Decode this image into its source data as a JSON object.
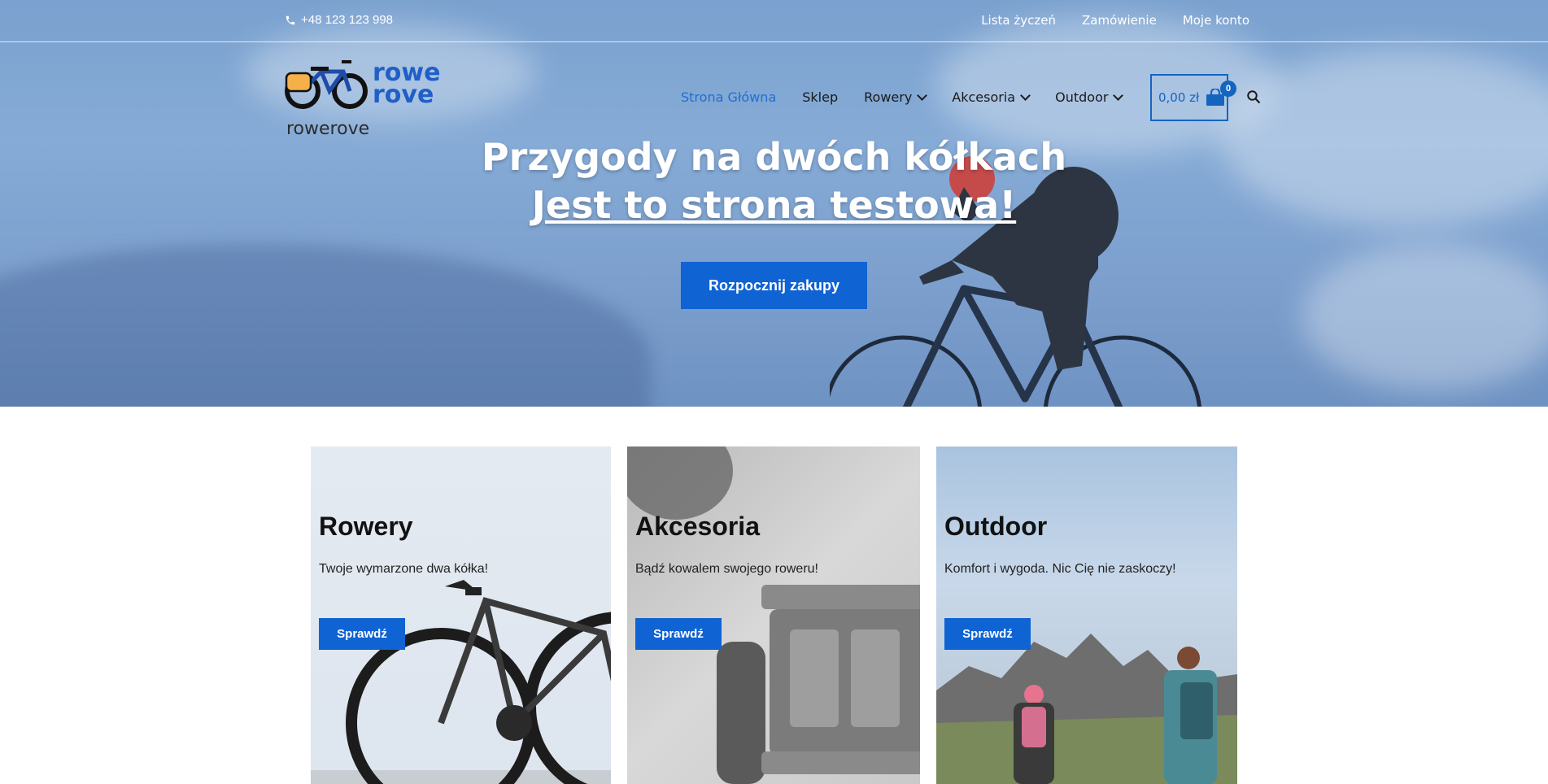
{
  "topbar": {
    "phone": "+48 123 123 998",
    "links": [
      "Lista życzeń",
      "Zamówienie",
      "Moje konto"
    ]
  },
  "header": {
    "logo_text_line1": "rowe",
    "logo_text_line2": "rove",
    "site_name": "rowerove",
    "nav": [
      {
        "label": "Strona Główna",
        "active": true,
        "dropdown": false
      },
      {
        "label": "Sklep",
        "active": false,
        "dropdown": false
      },
      {
        "label": "Rowery",
        "active": false,
        "dropdown": true
      },
      {
        "label": "Akcesoria",
        "active": false,
        "dropdown": true
      },
      {
        "label": "Outdoor",
        "active": false,
        "dropdown": true
      }
    ],
    "cart": {
      "amount": "0,00 zł",
      "count": "0"
    }
  },
  "hero": {
    "title": "Przygody na dwóch kółkach",
    "subtitle": "Jest to strona testowa!",
    "cta": "Rozpocznij zakupy"
  },
  "cards": [
    {
      "title": "Rowery",
      "text": "Twoje wymarzone dwa kółka!",
      "button": "Sprawdź"
    },
    {
      "title": "Akcesoria",
      "text": "Bądź kowalem swojego roweru!",
      "button": "Sprawdź"
    },
    {
      "title": "Outdoor",
      "text": "Komfort i wygoda. Nic Cię nie zaskoczy!",
      "button": "Sprawdź"
    }
  ],
  "colors": {
    "accent": "#0f63d3",
    "nav_active": "#1f6fd1",
    "cart": "#1565c0"
  }
}
